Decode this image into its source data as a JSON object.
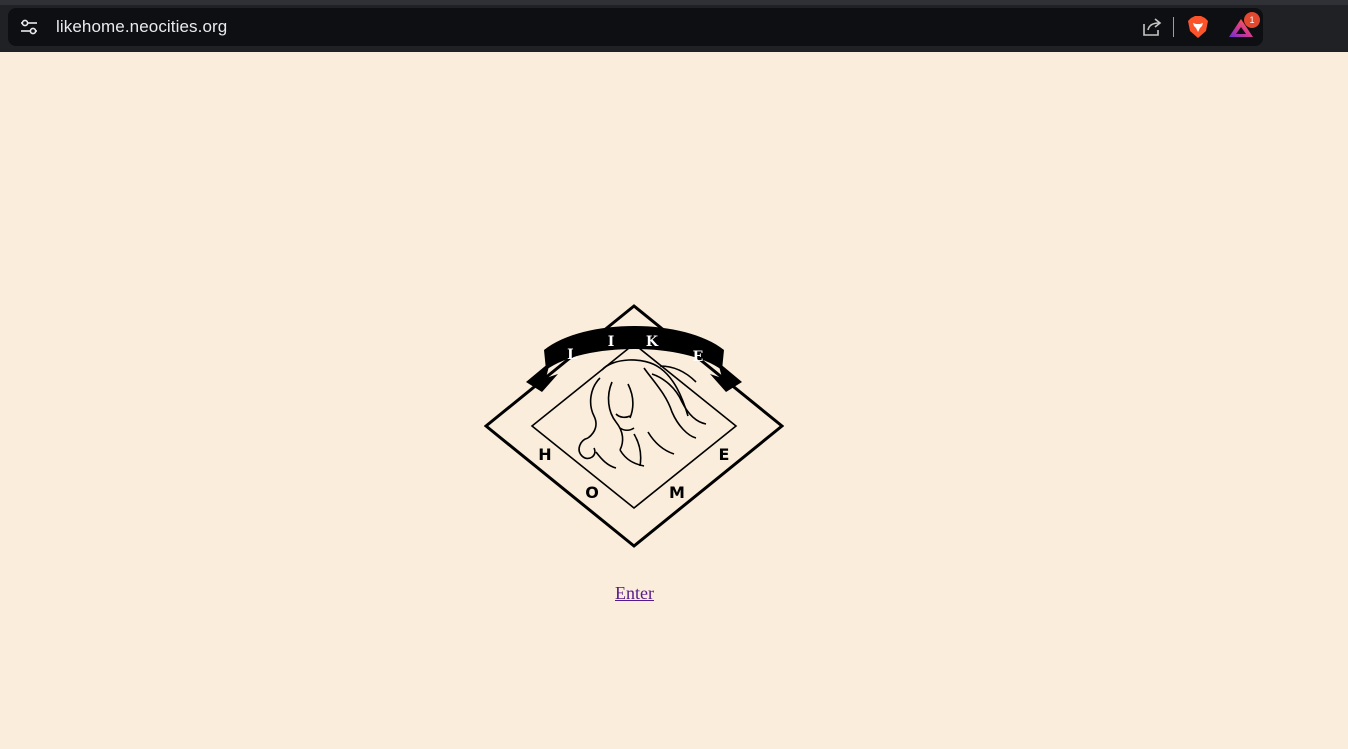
{
  "browser": {
    "url": "likehome.neocities.org",
    "rewards_badge": "1",
    "icons": {
      "site_settings": "tune-icon",
      "share": "share-icon",
      "shield": "brave-shield-icon",
      "rewards": "brave-rewards-icon"
    }
  },
  "page": {
    "background": "#faeddb",
    "logo": {
      "banner_letters": [
        "L",
        "I",
        "K",
        "E"
      ],
      "side_letters": [
        "H",
        "E"
      ],
      "bottom_letters": [
        "O",
        "M"
      ]
    },
    "enter_link": "Enter",
    "link_color": "#551a8b"
  }
}
